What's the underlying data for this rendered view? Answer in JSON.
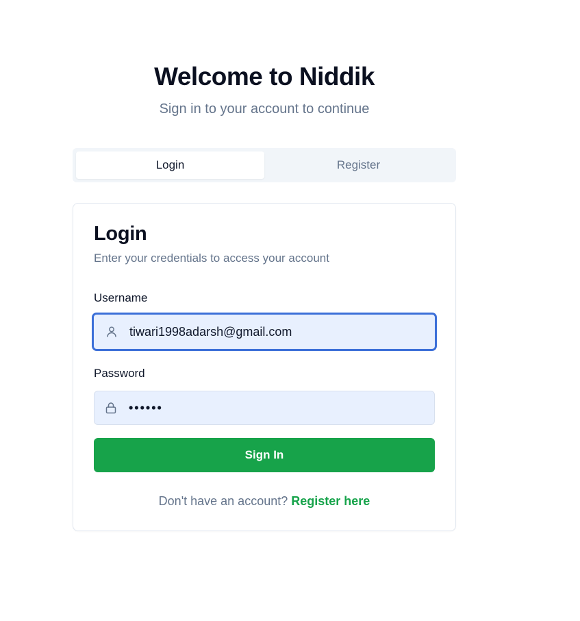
{
  "header": {
    "title": "Welcome to Niddik",
    "subtitle": "Sign in to your account to continue"
  },
  "tabs": {
    "login_label": "Login",
    "register_label": "Register",
    "active": "Login"
  },
  "card": {
    "title": "Login",
    "description": "Enter your credentials to access your account",
    "username": {
      "label": "Username",
      "value": "tiwari1998adarsh@gmail.com",
      "icon": "user-icon"
    },
    "password": {
      "label": "Password",
      "value": "••••••",
      "icon": "lock-icon"
    },
    "submit_label": "Sign In",
    "footer_text": "Don't have an account?",
    "footer_link": "Register here"
  },
  "colors": {
    "primary_green": "#17a34a",
    "link_green": "#16a34a",
    "input_bg": "#e8f0fe",
    "focus_ring": "#3b6fd8",
    "muted_text": "#64748b"
  }
}
